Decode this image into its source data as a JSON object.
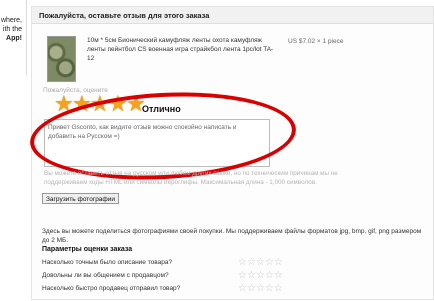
{
  "sidebar": {
    "lines": [
      "where,",
      "ith the",
      "App!"
    ]
  },
  "header": {
    "title": "Пожалуйста, оставьте отзыв для этого заказа"
  },
  "product": {
    "title": "10м * 5см Бионический камуфляж ленты охота камуфляж ленты пейнтбол CS военная игра страйкбол лента 1рс/lot TA-12",
    "price": "US $7.02 × 1 piece"
  },
  "review": {
    "prompt": "Пожалуйста, оцените",
    "rating_value": 5,
    "rating_max": 5,
    "rating_label": "Отлично",
    "text": "Привет Gsconto, как видите отзыв можно спокойно написать и добавить на Русском =)",
    "hint": "Вы можете оставить отзыв на русском или любом других языке, но по техническим причинам мы не поддерживаем коды HTML или символы иероглифы. Максимальная длина - 1,000 символов.",
    "upload_label": "Загрузить фотографии"
  },
  "photos": {
    "info": "Здесь вы можете поделиться фотографиями своей покупки. Мы поддерживаем файлы форматов jpg, bmp, gif, png размером до 2 МБ."
  },
  "params": {
    "title": "Параметры оценки заказа",
    "questions": [
      "Насколько точным было описание товара?",
      "Довольны ли вы общением с продавцом?",
      "Насколько быстро продавец отправил товар?"
    ]
  },
  "colors": {
    "star": "#f6a21a",
    "highlight": "#d90000",
    "empty_star": "#c8c8c8"
  },
  "icons": {
    "rating": "star-icon",
    "product": "camouflage-tape-thumbnail"
  }
}
